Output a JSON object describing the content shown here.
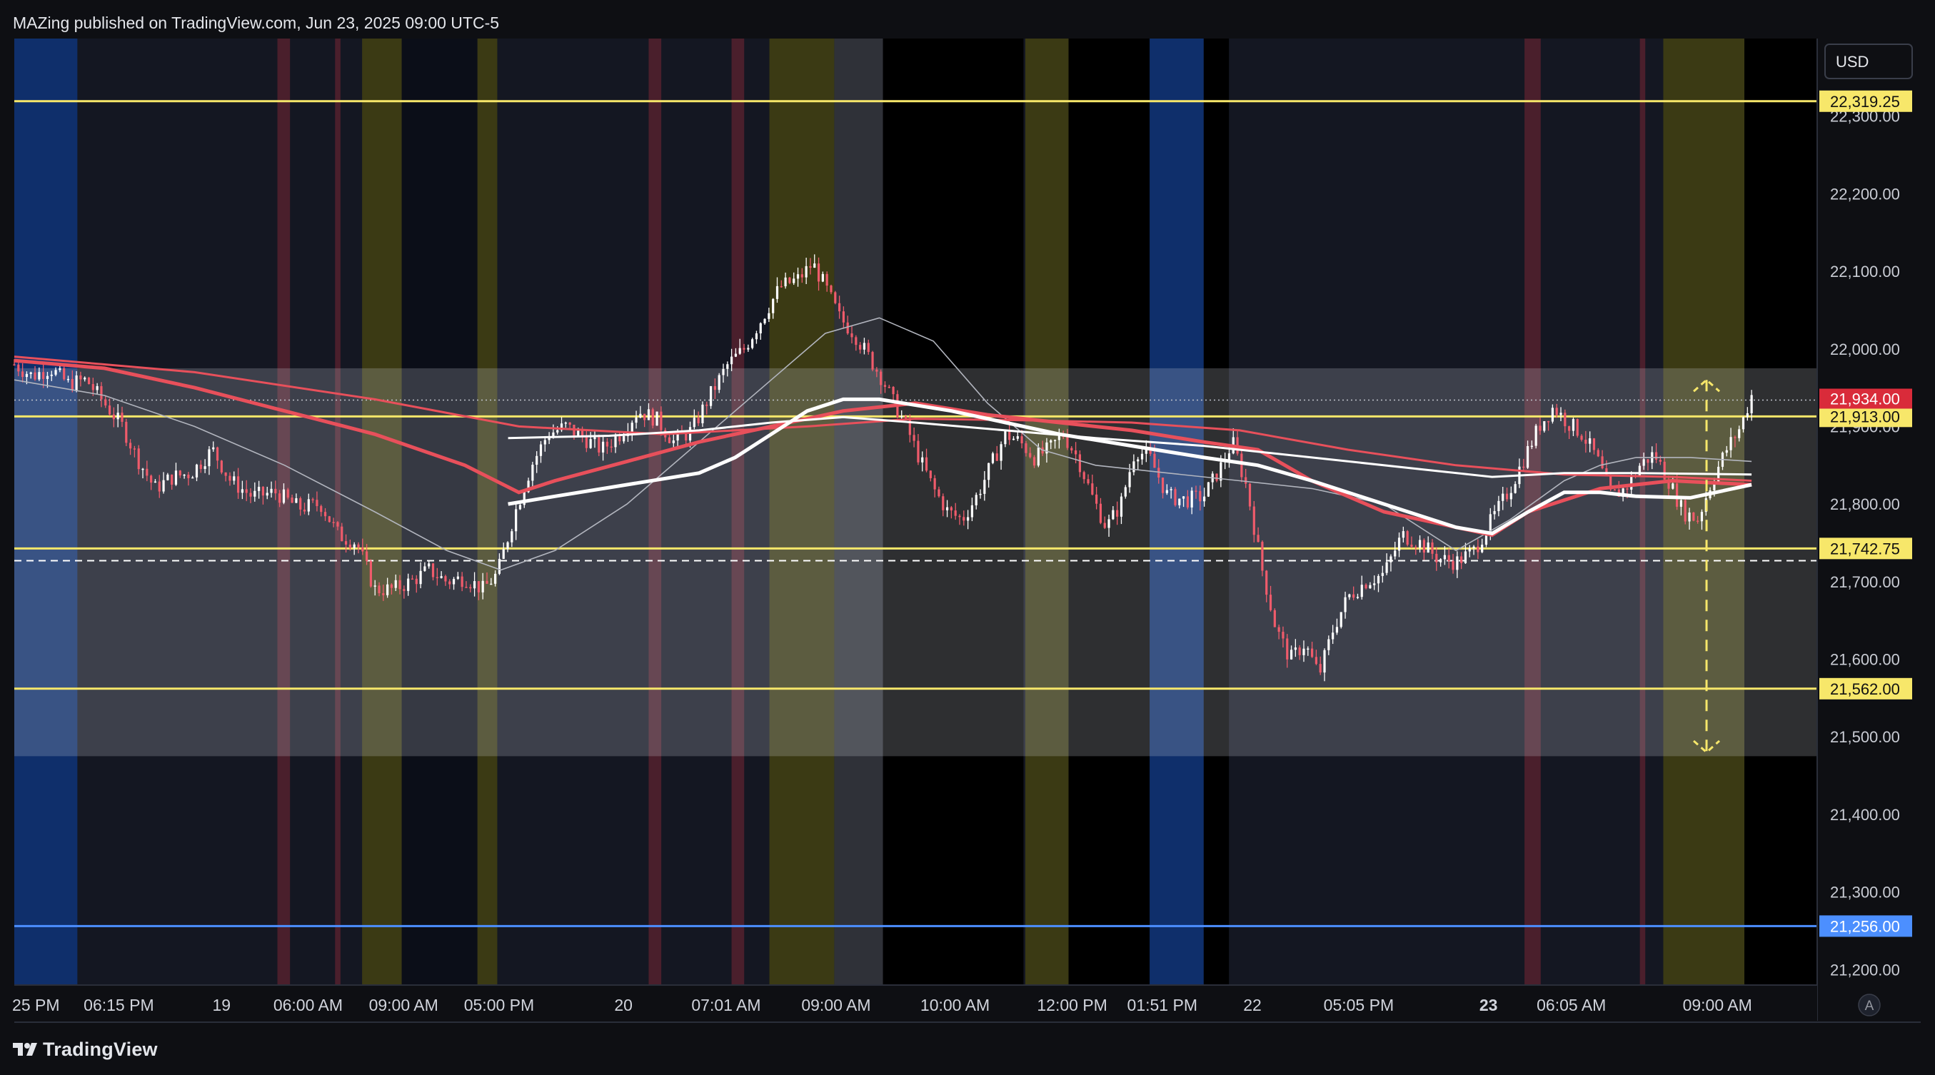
{
  "header": {
    "title": "MAZing published on TradingView.com, Jun 23, 2025 09:00 UTC-5"
  },
  "footer": {
    "brand": "TradingView"
  },
  "currency_button": "USD",
  "auto_scale_button": "A",
  "colors": {
    "bull": "#ffffff",
    "bear": "#ef5b6b",
    "ma_red": "#e8505b",
    "ma_white": "#ffffff",
    "ma_thin": "#b2b5be",
    "level_yellow": "#f7e76a",
    "level_blue": "#4c8fff",
    "session_blue": "#0f2f6b",
    "session_red": "#4a1f2c",
    "session_yellow": "#3b3a14",
    "session_gray": "#2f3138",
    "zone": "rgba(210,215,225,0.22)"
  },
  "chart_data": {
    "type": "candlestick",
    "symbol_hint": "",
    "ylim": [
      21180,
      22400
    ],
    "y_ticks": [
      "22,300.00",
      "22,200.00",
      "22,100.00",
      "22,000.00",
      "21,900.00",
      "21,800.00",
      "21,700.00",
      "21,600.00",
      "21,500.00",
      "21,400.00",
      "21,300.00",
      "21,200.00"
    ],
    "y_tick_values": [
      22300,
      22200,
      22100,
      22000,
      21900,
      21800,
      21700,
      21600,
      21500,
      21400,
      21300,
      21200
    ],
    "x_ticks": [
      "25 PM",
      "06:15 PM",
      "19",
      "06:00 AM",
      "09:00 AM",
      "05:00 PM",
      "20",
      "07:01 AM",
      "09:00 AM",
      "10:00 AM",
      "12:00 PM",
      "01:51 PM",
      "22",
      "05:05 PM",
      "23",
      "06:05 AM",
      "09:00 AM"
    ],
    "x_tick_bold": [
      false,
      false,
      false,
      false,
      false,
      false,
      false,
      false,
      false,
      false,
      false,
      false,
      false,
      false,
      true,
      false,
      false
    ],
    "x_tick_positions": [
      0.012,
      0.058,
      0.115,
      0.163,
      0.216,
      0.269,
      0.338,
      0.395,
      0.456,
      0.522,
      0.587,
      0.637,
      0.687,
      0.746,
      0.818,
      0.864,
      0.945
    ],
    "horizontal_levels": [
      {
        "value": 22319.25,
        "label": "22,319.25",
        "color": "#f7e76a",
        "style": "solid"
      },
      {
        "value": 21913.0,
        "label": "21,913.00",
        "color": "#f7e76a",
        "style": "solid"
      },
      {
        "value": 21742.75,
        "label": "21,742.75",
        "color": "#f7e76a",
        "style": "solid"
      },
      {
        "value": 21562.0,
        "label": "21,562.00",
        "color": "#f7e76a",
        "style": "solid"
      },
      {
        "value": 21256.0,
        "label": "21,256.00",
        "color": "#4c8fff",
        "style": "solid"
      },
      {
        "value": 21727,
        "label": "",
        "color": "#ffffff",
        "style": "dashed"
      }
    ],
    "last_price": {
      "value": 21934.0,
      "label": "21,934.00"
    },
    "zone": {
      "top": 21975,
      "bottom": 21475
    },
    "sessions": [
      {
        "x0": 0.0,
        "x1": 0.035,
        "kind": "blue"
      },
      {
        "x0": 0.146,
        "x1": 0.153,
        "kind": "red"
      },
      {
        "x0": 0.178,
        "x1": 0.181,
        "kind": "red"
      },
      {
        "x0": 0.193,
        "x1": 0.215,
        "kind": "yellow"
      },
      {
        "x0": 0.215,
        "x1": 0.257,
        "kind": "dark"
      },
      {
        "x0": 0.257,
        "x1": 0.268,
        "kind": "yellow"
      },
      {
        "x0": 0.352,
        "x1": 0.359,
        "kind": "red"
      },
      {
        "x0": 0.398,
        "x1": 0.405,
        "kind": "red"
      },
      {
        "x0": 0.419,
        "x1": 0.455,
        "kind": "yellow"
      },
      {
        "x0": 0.455,
        "x1": 0.482,
        "kind": "gray"
      },
      {
        "x0": 0.482,
        "x1": 0.56,
        "kind": "black"
      },
      {
        "x0": 0.561,
        "x1": 0.585,
        "kind": "yellow"
      },
      {
        "x0": 0.585,
        "x1": 0.63,
        "kind": "black"
      },
      {
        "x0": 0.63,
        "x1": 0.66,
        "kind": "blue"
      },
      {
        "x0": 0.66,
        "x1": 0.674,
        "kind": "black"
      },
      {
        "x0": 0.838,
        "x1": 0.847,
        "kind": "red"
      },
      {
        "x0": 0.902,
        "x1": 0.905,
        "kind": "red"
      },
      {
        "x0": 0.915,
        "x1": 0.96,
        "kind": "yellow"
      },
      {
        "x0": 0.96,
        "x1": 1.0,
        "kind": "black"
      }
    ],
    "price_path": [
      [
        0.0,
        21980
      ],
      [
        0.01,
        21965
      ],
      [
        0.02,
        21975
      ],
      [
        0.03,
        21955
      ],
      [
        0.04,
        21960
      ],
      [
        0.05,
        21930
      ],
      [
        0.06,
        21900
      ],
      [
        0.068,
        21860
      ],
      [
        0.078,
        21820
      ],
      [
        0.088,
        21835
      ],
      [
        0.098,
        21840
      ],
      [
        0.11,
        21870
      ],
      [
        0.12,
        21830
      ],
      [
        0.132,
        21810
      ],
      [
        0.145,
        21815
      ],
      [
        0.158,
        21795
      ],
      [
        0.17,
        21800
      ],
      [
        0.18,
        21760
      ],
      [
        0.19,
        21750
      ],
      [
        0.2,
        21690
      ],
      [
        0.21,
        21690
      ],
      [
        0.22,
        21700
      ],
      [
        0.23,
        21715
      ],
      [
        0.24,
        21700
      ],
      [
        0.25,
        21705
      ],
      [
        0.26,
        21690
      ],
      [
        0.268,
        21710
      ],
      [
        0.278,
        21790
      ],
      [
        0.287,
        21850
      ],
      [
        0.296,
        21890
      ],
      [
        0.306,
        21900
      ],
      [
        0.316,
        21885
      ],
      [
        0.326,
        21870
      ],
      [
        0.336,
        21890
      ],
      [
        0.346,
        21920
      ],
      [
        0.356,
        21910
      ],
      [
        0.366,
        21880
      ],
      [
        0.376,
        21895
      ],
      [
        0.386,
        21940
      ],
      [
        0.396,
        21980
      ],
      [
        0.405,
        22000
      ],
      [
        0.415,
        22040
      ],
      [
        0.425,
        22080
      ],
      [
        0.435,
        22090
      ],
      [
        0.443,
        22110
      ],
      [
        0.45,
        22080
      ],
      [
        0.458,
        22040
      ],
      [
        0.466,
        22020
      ],
      [
        0.474,
        21990
      ],
      [
        0.482,
        21960
      ],
      [
        0.488,
        21930
      ],
      [
        0.495,
        21900
      ],
      [
        0.502,
        21860
      ],
      [
        0.51,
        21820
      ],
      [
        0.518,
        21790
      ],
      [
        0.526,
        21780
      ],
      [
        0.534,
        21810
      ],
      [
        0.542,
        21850
      ],
      [
        0.55,
        21890
      ],
      [
        0.558,
        21880
      ],
      [
        0.566,
        21860
      ],
      [
        0.574,
        21870
      ],
      [
        0.582,
        21890
      ],
      [
        0.59,
        21860
      ],
      [
        0.598,
        21810
      ],
      [
        0.606,
        21770
      ],
      [
        0.614,
        21800
      ],
      [
        0.622,
        21870
      ],
      [
        0.63,
        21860
      ],
      [
        0.64,
        21810
      ],
      [
        0.65,
        21805
      ],
      [
        0.66,
        21810
      ],
      [
        0.67,
        21850
      ],
      [
        0.676,
        21880
      ],
      [
        0.684,
        21820
      ],
      [
        0.692,
        21720
      ],
      [
        0.7,
        21640
      ],
      [
        0.708,
        21600
      ],
      [
        0.716,
        21620
      ],
      [
        0.724,
        21580
      ],
      [
        0.732,
        21640
      ],
      [
        0.74,
        21680
      ],
      [
        0.75,
        21700
      ],
      [
        0.76,
        21710
      ],
      [
        0.77,
        21760
      ],
      [
        0.78,
        21750
      ],
      [
        0.79,
        21730
      ],
      [
        0.8,
        21725
      ],
      [
        0.81,
        21740
      ],
      [
        0.82,
        21780
      ],
      [
        0.83,
        21820
      ],
      [
        0.838,
        21860
      ],
      [
        0.846,
        21900
      ],
      [
        0.854,
        21925
      ],
      [
        0.862,
        21905
      ],
      [
        0.87,
        21890
      ],
      [
        0.878,
        21860
      ],
      [
        0.886,
        21810
      ],
      [
        0.894,
        21820
      ],
      [
        0.902,
        21850
      ],
      [
        0.91,
        21865
      ],
      [
        0.918,
        21830
      ],
      [
        0.926,
        21790
      ],
      [
        0.934,
        21780
      ],
      [
        0.942,
        21830
      ],
      [
        0.95,
        21870
      ],
      [
        0.958,
        21900
      ],
      [
        0.964,
        21940
      ]
    ],
    "ma_red_path": [
      [
        0.0,
        21985
      ],
      [
        0.05,
        21975
      ],
      [
        0.1,
        21950
      ],
      [
        0.15,
        21920
      ],
      [
        0.2,
        21890
      ],
      [
        0.25,
        21850
      ],
      [
        0.28,
        21815
      ],
      [
        0.3,
        21830
      ],
      [
        0.34,
        21855
      ],
      [
        0.38,
        21880
      ],
      [
        0.42,
        21900
      ],
      [
        0.46,
        21920
      ],
      [
        0.5,
        21930
      ],
      [
        0.54,
        21915
      ],
      [
        0.58,
        21905
      ],
      [
        0.62,
        21895
      ],
      [
        0.66,
        21880
      ],
      [
        0.69,
        21870
      ],
      [
        0.72,
        21830
      ],
      [
        0.76,
        21790
      ],
      [
        0.8,
        21770
      ],
      [
        0.82,
        21760
      ],
      [
        0.84,
        21790
      ],
      [
        0.88,
        21820
      ],
      [
        0.92,
        21830
      ],
      [
        0.964,
        21825
      ]
    ],
    "ma_red2_path": [
      [
        0.0,
        21990
      ],
      [
        0.1,
        21970
      ],
      [
        0.2,
        21935
      ],
      [
        0.28,
        21900
      ],
      [
        0.36,
        21890
      ],
      [
        0.44,
        21900
      ],
      [
        0.5,
        21910
      ],
      [
        0.56,
        21908
      ],
      [
        0.62,
        21905
      ],
      [
        0.68,
        21895
      ],
      [
        0.74,
        21870
      ],
      [
        0.8,
        21850
      ],
      [
        0.86,
        21838
      ],
      [
        0.92,
        21835
      ],
      [
        0.964,
        21830
      ]
    ],
    "ma_white_path": [
      [
        0.274,
        21800
      ],
      [
        0.3,
        21810
      ],
      [
        0.34,
        21825
      ],
      [
        0.38,
        21840
      ],
      [
        0.4,
        21860
      ],
      [
        0.42,
        21890
      ],
      [
        0.44,
        21920
      ],
      [
        0.46,
        21935
      ],
      [
        0.48,
        21935
      ],
      [
        0.52,
        21920
      ],
      [
        0.55,
        21905
      ],
      [
        0.58,
        21890
      ],
      [
        0.62,
        21875
      ],
      [
        0.66,
        21860
      ],
      [
        0.69,
        21850
      ],
      [
        0.72,
        21830
      ],
      [
        0.76,
        21800
      ],
      [
        0.8,
        21770
      ],
      [
        0.82,
        21762
      ],
      [
        0.84,
        21790
      ],
      [
        0.86,
        21815
      ],
      [
        0.88,
        21815
      ],
      [
        0.9,
        21810
      ],
      [
        0.93,
        21808
      ],
      [
        0.964,
        21825
      ]
    ],
    "ma_white2_path": [
      [
        0.274,
        21885
      ],
      [
        0.33,
        21888
      ],
      [
        0.38,
        21895
      ],
      [
        0.42,
        21905
      ],
      [
        0.46,
        21912
      ],
      [
        0.5,
        21905
      ],
      [
        0.55,
        21895
      ],
      [
        0.6,
        21885
      ],
      [
        0.66,
        21875
      ],
      [
        0.72,
        21860
      ],
      [
        0.78,
        21845
      ],
      [
        0.82,
        21835
      ],
      [
        0.86,
        21840
      ],
      [
        0.9,
        21840
      ],
      [
        0.964,
        21838
      ]
    ],
    "ma_thin_path": [
      [
        0.0,
        21960
      ],
      [
        0.05,
        21940
      ],
      [
        0.1,
        21900
      ],
      [
        0.15,
        21850
      ],
      [
        0.2,
        21790
      ],
      [
        0.24,
        21740
      ],
      [
        0.27,
        21715
      ],
      [
        0.3,
        21740
      ],
      [
        0.34,
        21800
      ],
      [
        0.38,
        21880
      ],
      [
        0.42,
        21960
      ],
      [
        0.45,
        22020
      ],
      [
        0.48,
        22040
      ],
      [
        0.51,
        22010
      ],
      [
        0.54,
        21930
      ],
      [
        0.57,
        21870
      ],
      [
        0.6,
        21850
      ],
      [
        0.64,
        21840
      ],
      [
        0.68,
        21830
      ],
      [
        0.72,
        21820
      ],
      [
        0.76,
        21800
      ],
      [
        0.8,
        21740
      ],
      [
        0.83,
        21780
      ],
      [
        0.86,
        21830
      ],
      [
        0.88,
        21850
      ],
      [
        0.9,
        21860
      ],
      [
        0.93,
        21860
      ],
      [
        0.964,
        21855
      ]
    ],
    "projection_arrow": {
      "x": 0.939,
      "from": 21960,
      "to": 21480
    }
  }
}
